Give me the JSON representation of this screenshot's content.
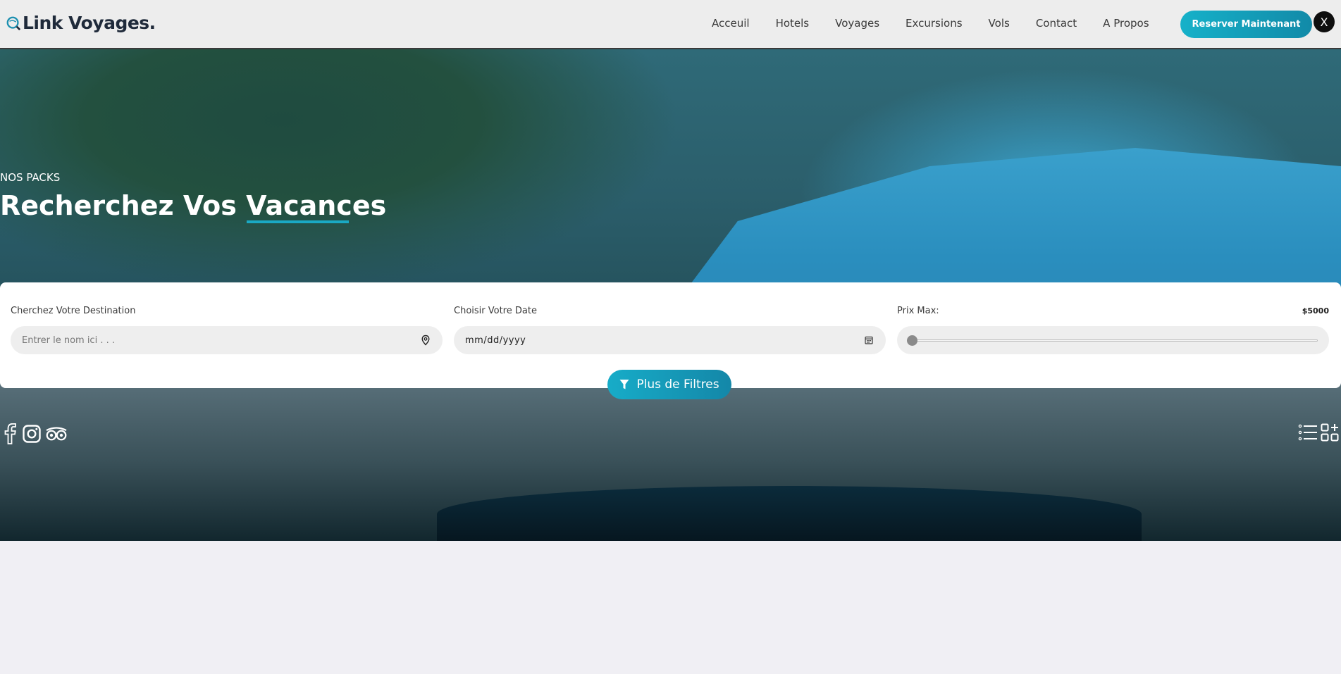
{
  "brand": {
    "name": "Link Voyages."
  },
  "nav": {
    "items": [
      "Acceuil",
      "Hotels",
      "Voyages",
      "Excursions",
      "Vols",
      "Contact",
      "A Propos"
    ],
    "cta_label": "Reserver Maintenant",
    "close_label": "X"
  },
  "hero": {
    "kicker": "NOS PACKS",
    "title": "Recherchez Vos Vacances"
  },
  "search": {
    "destination_label": "Cherchez Votre Destination",
    "destination_placeholder": "Entrer le nom ici . . .",
    "date_label": "Choisir Votre Date",
    "date_value": "mm/dd/yyyy",
    "price_label": "Prix Max:",
    "price_value": "$5000",
    "price_slider_fraction": 0,
    "filters_label": "Plus de Filtres"
  },
  "socials": [
    "facebook-icon",
    "instagram-icon",
    "tripadvisor-icon"
  ],
  "view_toggles": [
    "list-view-icon",
    "grid-view-icon"
  ],
  "colors": {
    "accent": "#16b1c9",
    "accent_dark": "#128aa8",
    "header_bg": "#ededed",
    "page_bg": "#f0eff4"
  }
}
